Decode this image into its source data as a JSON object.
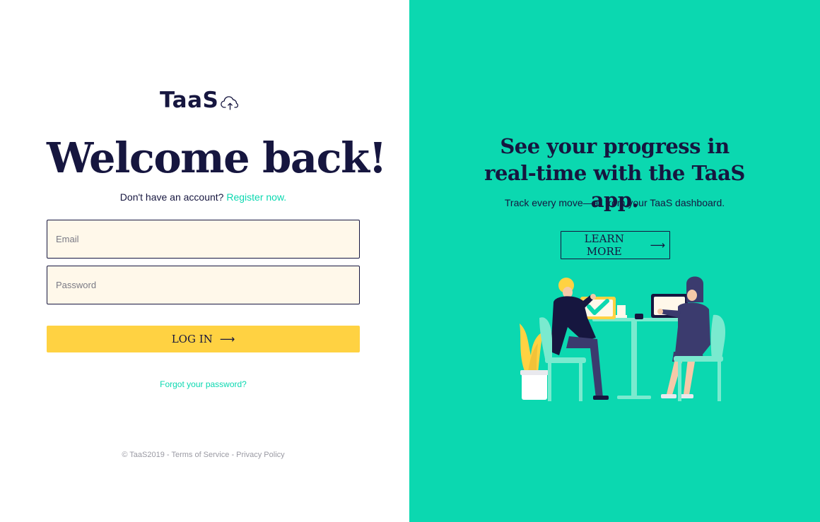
{
  "brand": {
    "name": "TaaS",
    "icon": "cloud-upload-icon"
  },
  "login": {
    "heading": "Welcome back!",
    "register_prompt": "Don't have an account?",
    "register_link": "Register now.",
    "email_placeholder": "Email",
    "email_value": "",
    "password_placeholder": "Password",
    "password_value": "",
    "submit_label": "LOG IN",
    "submit_arrow": "⟶",
    "forgot_link": "Forgot your password?"
  },
  "footer": {
    "copyright": "© TaaS2019",
    "separator": "-",
    "terms": "Terms of Service",
    "privacy": "Privacy Policy"
  },
  "promo": {
    "title": "See your progress in real-time with the TaaS app.",
    "subtitle": "Track every move—all from your TaaS dashboard.",
    "cta_label": "LEARN MORE",
    "cta_arrow": "⟶",
    "illustration": "two-people-working-at-table-illustration"
  },
  "colors": {
    "accent": "#0bd8b0",
    "primary_button": "#ffd242",
    "dark": "#16163f",
    "input_bg": "#fff8ea"
  }
}
